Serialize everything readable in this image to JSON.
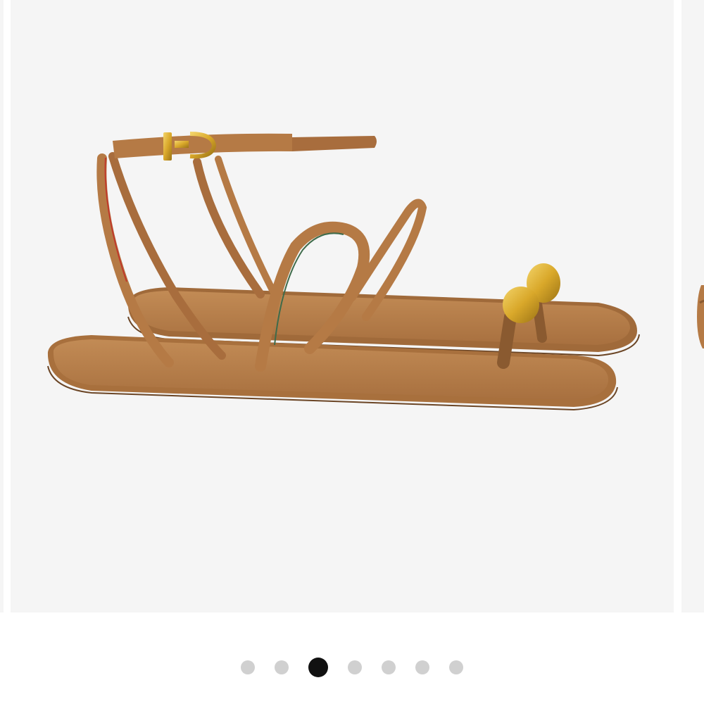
{
  "product_image": {
    "subject": "sandal",
    "colors": {
      "background": "#f5f5f5",
      "leather": "#b57a45",
      "sole": "#c08a55",
      "gold_hardware": "#d9a82a"
    }
  },
  "pagination": {
    "total": 7,
    "active_index": 2,
    "colors": {
      "active": "#111111",
      "inactive": "#d0d0d0"
    }
  }
}
